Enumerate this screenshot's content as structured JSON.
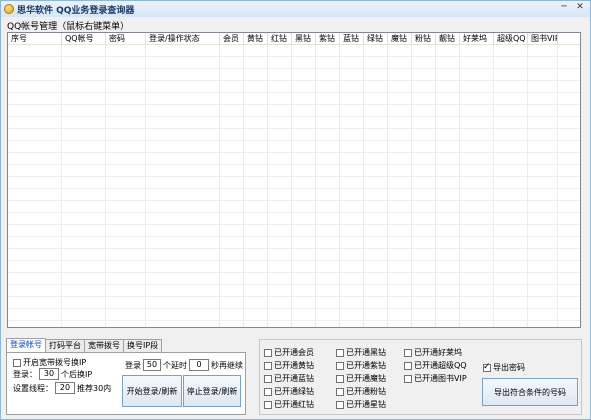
{
  "window": {
    "title": "思华软件 QQ业务登录查询器"
  },
  "group": {
    "label": "QQ帐号管理（鼠标右键菜单）"
  },
  "grid": {
    "columns": [
      "序号",
      "QQ帐号",
      "密码",
      "登录/操作状态",
      "会员",
      "黄钻",
      "红钻",
      "黑钻",
      "紫钻",
      "蓝钻",
      "绿钻",
      "魔钻",
      "粉钻",
      "靓钻",
      "好莱坞",
      "超级QQ",
      "图书VIP"
    ]
  },
  "tabs": [
    "登录帐号",
    "打码平台",
    "宽带拨号",
    "换号IP段"
  ],
  "login_panel": {
    "enable_dial_label": "开启宽带拨号换IP",
    "enable_dial_checked": false,
    "login_prefix": "登录：",
    "login_count": "30",
    "login_suffix": "个后换IP",
    "threads_prefix": "设置线程：",
    "threads_value": "20",
    "threads_suffix": "推荐30内",
    "batch_prefix": "登录",
    "batch_value": "50",
    "delay_prefix": "个延时",
    "delay_value": "0",
    "delay_suffix": "秒再继续",
    "start_button": "开始登录/刷新",
    "stop_button": "停止登录/刷新"
  },
  "rights": {
    "col1": [
      "已开通会员",
      "已开通黄钻",
      "已开通蓝钻",
      "已开通绿钻",
      "已开通红钻"
    ],
    "col2": [
      "已开通黑钻",
      "已开通紫钻",
      "已开通魔钻",
      "已开通粉钻",
      "已开通星钻"
    ],
    "col3": [
      "已开通好莱坞",
      "已开通超级QQ",
      "已开通图书VIP"
    ]
  },
  "export": {
    "export_password_label": "导出密码",
    "export_password_checked": true,
    "export_button": "导出符合条件的号码"
  },
  "window_controls": {
    "minimize": "─",
    "close": "✕"
  }
}
